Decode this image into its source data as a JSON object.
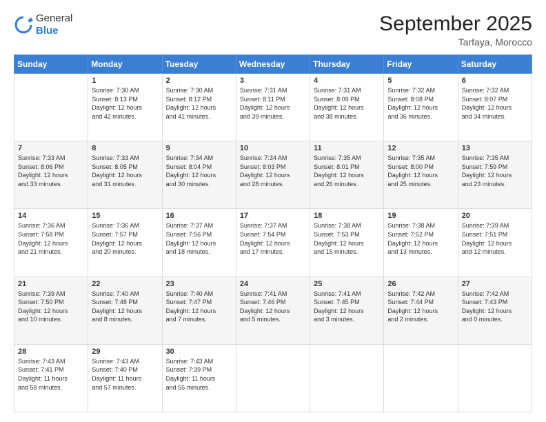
{
  "logo": {
    "general": "General",
    "blue": "Blue"
  },
  "header": {
    "month": "September 2025",
    "location": "Tarfaya, Morocco"
  },
  "days_of_week": [
    "Sunday",
    "Monday",
    "Tuesday",
    "Wednesday",
    "Thursday",
    "Friday",
    "Saturday"
  ],
  "weeks": [
    [
      {
        "day": "",
        "info": ""
      },
      {
        "day": "1",
        "info": "Sunrise: 7:30 AM\nSunset: 8:13 PM\nDaylight: 12 hours\nand 42 minutes."
      },
      {
        "day": "2",
        "info": "Sunrise: 7:30 AM\nSunset: 8:12 PM\nDaylight: 12 hours\nand 41 minutes."
      },
      {
        "day": "3",
        "info": "Sunrise: 7:31 AM\nSunset: 8:11 PM\nDaylight: 12 hours\nand 39 minutes."
      },
      {
        "day": "4",
        "info": "Sunrise: 7:31 AM\nSunset: 8:09 PM\nDaylight: 12 hours\nand 38 minutes."
      },
      {
        "day": "5",
        "info": "Sunrise: 7:32 AM\nSunset: 8:08 PM\nDaylight: 12 hours\nand 36 minutes."
      },
      {
        "day": "6",
        "info": "Sunrise: 7:32 AM\nSunset: 8:07 PM\nDaylight: 12 hours\nand 34 minutes."
      }
    ],
    [
      {
        "day": "7",
        "info": "Sunrise: 7:33 AM\nSunset: 8:06 PM\nDaylight: 12 hours\nand 33 minutes."
      },
      {
        "day": "8",
        "info": "Sunrise: 7:33 AM\nSunset: 8:05 PM\nDaylight: 12 hours\nand 31 minutes."
      },
      {
        "day": "9",
        "info": "Sunrise: 7:34 AM\nSunset: 8:04 PM\nDaylight: 12 hours\nand 30 minutes."
      },
      {
        "day": "10",
        "info": "Sunrise: 7:34 AM\nSunset: 8:03 PM\nDaylight: 12 hours\nand 28 minutes."
      },
      {
        "day": "11",
        "info": "Sunrise: 7:35 AM\nSunset: 8:01 PM\nDaylight: 12 hours\nand 26 minutes."
      },
      {
        "day": "12",
        "info": "Sunrise: 7:35 AM\nSunset: 8:00 PM\nDaylight: 12 hours\nand 25 minutes."
      },
      {
        "day": "13",
        "info": "Sunrise: 7:35 AM\nSunset: 7:59 PM\nDaylight: 12 hours\nand 23 minutes."
      }
    ],
    [
      {
        "day": "14",
        "info": "Sunrise: 7:36 AM\nSunset: 7:58 PM\nDaylight: 12 hours\nand 21 minutes."
      },
      {
        "day": "15",
        "info": "Sunrise: 7:36 AM\nSunset: 7:57 PM\nDaylight: 12 hours\nand 20 minutes."
      },
      {
        "day": "16",
        "info": "Sunrise: 7:37 AM\nSunset: 7:56 PM\nDaylight: 12 hours\nand 18 minutes."
      },
      {
        "day": "17",
        "info": "Sunrise: 7:37 AM\nSunset: 7:54 PM\nDaylight: 12 hours\nand 17 minutes."
      },
      {
        "day": "18",
        "info": "Sunrise: 7:38 AM\nSunset: 7:53 PM\nDaylight: 12 hours\nand 15 minutes."
      },
      {
        "day": "19",
        "info": "Sunrise: 7:38 AM\nSunset: 7:52 PM\nDaylight: 12 hours\nand 13 minutes."
      },
      {
        "day": "20",
        "info": "Sunrise: 7:39 AM\nSunset: 7:51 PM\nDaylight: 12 hours\nand 12 minutes."
      }
    ],
    [
      {
        "day": "21",
        "info": "Sunrise: 7:39 AM\nSunset: 7:50 PM\nDaylight: 12 hours\nand 10 minutes."
      },
      {
        "day": "22",
        "info": "Sunrise: 7:40 AM\nSunset: 7:48 PM\nDaylight: 12 hours\nand 8 minutes."
      },
      {
        "day": "23",
        "info": "Sunrise: 7:40 AM\nSunset: 7:47 PM\nDaylight: 12 hours\nand 7 minutes."
      },
      {
        "day": "24",
        "info": "Sunrise: 7:41 AM\nSunset: 7:46 PM\nDaylight: 12 hours\nand 5 minutes."
      },
      {
        "day": "25",
        "info": "Sunrise: 7:41 AM\nSunset: 7:45 PM\nDaylight: 12 hours\nand 3 minutes."
      },
      {
        "day": "26",
        "info": "Sunrise: 7:42 AM\nSunset: 7:44 PM\nDaylight: 12 hours\nand 2 minutes."
      },
      {
        "day": "27",
        "info": "Sunrise: 7:42 AM\nSunset: 7:43 PM\nDaylight: 12 hours\nand 0 minutes."
      }
    ],
    [
      {
        "day": "28",
        "info": "Sunrise: 7:43 AM\nSunset: 7:41 PM\nDaylight: 11 hours\nand 58 minutes."
      },
      {
        "day": "29",
        "info": "Sunrise: 7:43 AM\nSunset: 7:40 PM\nDaylight: 11 hours\nand 57 minutes."
      },
      {
        "day": "30",
        "info": "Sunrise: 7:43 AM\nSunset: 7:39 PM\nDaylight: 11 hours\nand 55 minutes."
      },
      {
        "day": "",
        "info": ""
      },
      {
        "day": "",
        "info": ""
      },
      {
        "day": "",
        "info": ""
      },
      {
        "day": "",
        "info": ""
      }
    ]
  ]
}
